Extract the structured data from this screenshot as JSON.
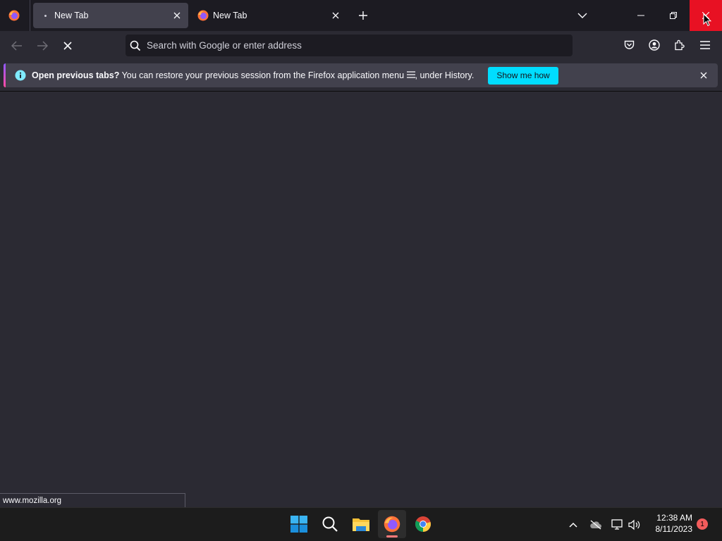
{
  "tabs": [
    {
      "title": "New Tab",
      "active": true
    },
    {
      "title": "New Tab",
      "active": false
    }
  ],
  "urlbar": {
    "placeholder": "Search with Google or enter address"
  },
  "notification": {
    "bold": "Open previous tabs?",
    "text_before_icon": " You can restore your previous session from the Firefox application menu ",
    "text_after_icon": ", under History.",
    "button": "Show me how"
  },
  "status_text": "www.mozilla.org",
  "clock": {
    "time": "12:38 AM",
    "date": "8/11/2023"
  },
  "notification_badge": "1",
  "colors": {
    "accent": "#00ddff",
    "close_hover": "#e81123",
    "toolbar": "#2b2a33",
    "tabstrip": "#1c1b22"
  },
  "icons": [
    "firefox-icon",
    "close-icon",
    "plus-icon",
    "chevron-down-icon",
    "minimize-icon",
    "restore-icon",
    "back-icon",
    "forward-icon",
    "stop-icon",
    "search-icon",
    "pocket-icon",
    "account-icon",
    "extensions-icon",
    "menu-icon",
    "info-icon",
    "windows-start-icon",
    "taskbar-search-icon",
    "file-explorer-icon",
    "chrome-icon"
  ]
}
